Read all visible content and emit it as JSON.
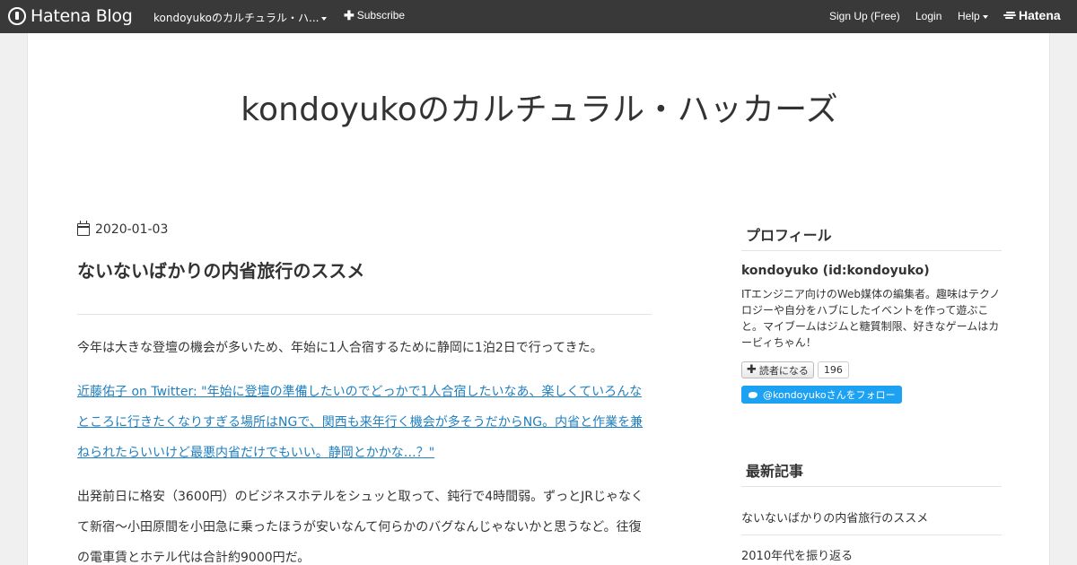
{
  "global_header": {
    "logo_text": "Hatena Blog",
    "blog_menu_label": "kondoyukoのカルチュラル・ハ...",
    "subscribe_label": "Subscribe",
    "signup_label": "Sign Up (Free)",
    "login_label": "Login",
    "help_label": "Help",
    "hatena_label": "Hatena",
    "background_color": "#393939"
  },
  "blog": {
    "title": "kondoyukoのカルチュラル・ハッカーズ"
  },
  "entry": {
    "date": "2020-01-03",
    "title": "ないないばかりの内省旅行のススメ",
    "paragraph1": "今年は大きな登壇の機会が多いため、年始に1人合宿するために静岡に1泊2日で行ってきた。",
    "tweet_link": "近藤佑子 on Twitter: \"年始に登壇の準備したいのでどっかで1人合宿したいなあ、楽しくていろんなところに行きたくなりすぎる場所はNGで、関西も来年行く機会が多そうだからNG。内省と作業を兼ねられたらいいけど最悪内省だけでもいい。静岡とかかな…？\"",
    "paragraph3": "出発前日に格安（3600円）のビジネスホテルをシュッと取って、鈍行で4時間弱。ずっとJRじゃなくて新宿〜小田原間を小田急に乗ったほうが安いなんて何らかのバグなんじゃないかと思うなど。往復の電車賃とホテル代は合計約9000円だ。",
    "link_color": "#2080c0"
  },
  "sidebar": {
    "profile_heading": "プロフィール",
    "profile_name": "kondoyuko (id:kondoyuko)",
    "profile_description": "ITエンジニア向けのWeb媒体の編集者。趣味はテクノロジーや自分をハブにしたイベントを作って遊ぶこと。マイブームはジムと糖質制限、好きなゲームはカービィちゃん！",
    "reader_button_label": "読者になる",
    "reader_count": "196",
    "twitter_follow_label": "@kondoyukoさんをフォロー",
    "twitter_color": "#1da1f2",
    "recent_heading": "最新記事",
    "recent_entries": [
      "ないないばかりの内省旅行のススメ",
      "2010年代を振り返る"
    ]
  },
  "icons": {
    "logo": "hatena-blog-logo-icon",
    "calendar": "calendar-icon",
    "plus": "plus-icon",
    "twitter": "twitter-bird-icon"
  }
}
